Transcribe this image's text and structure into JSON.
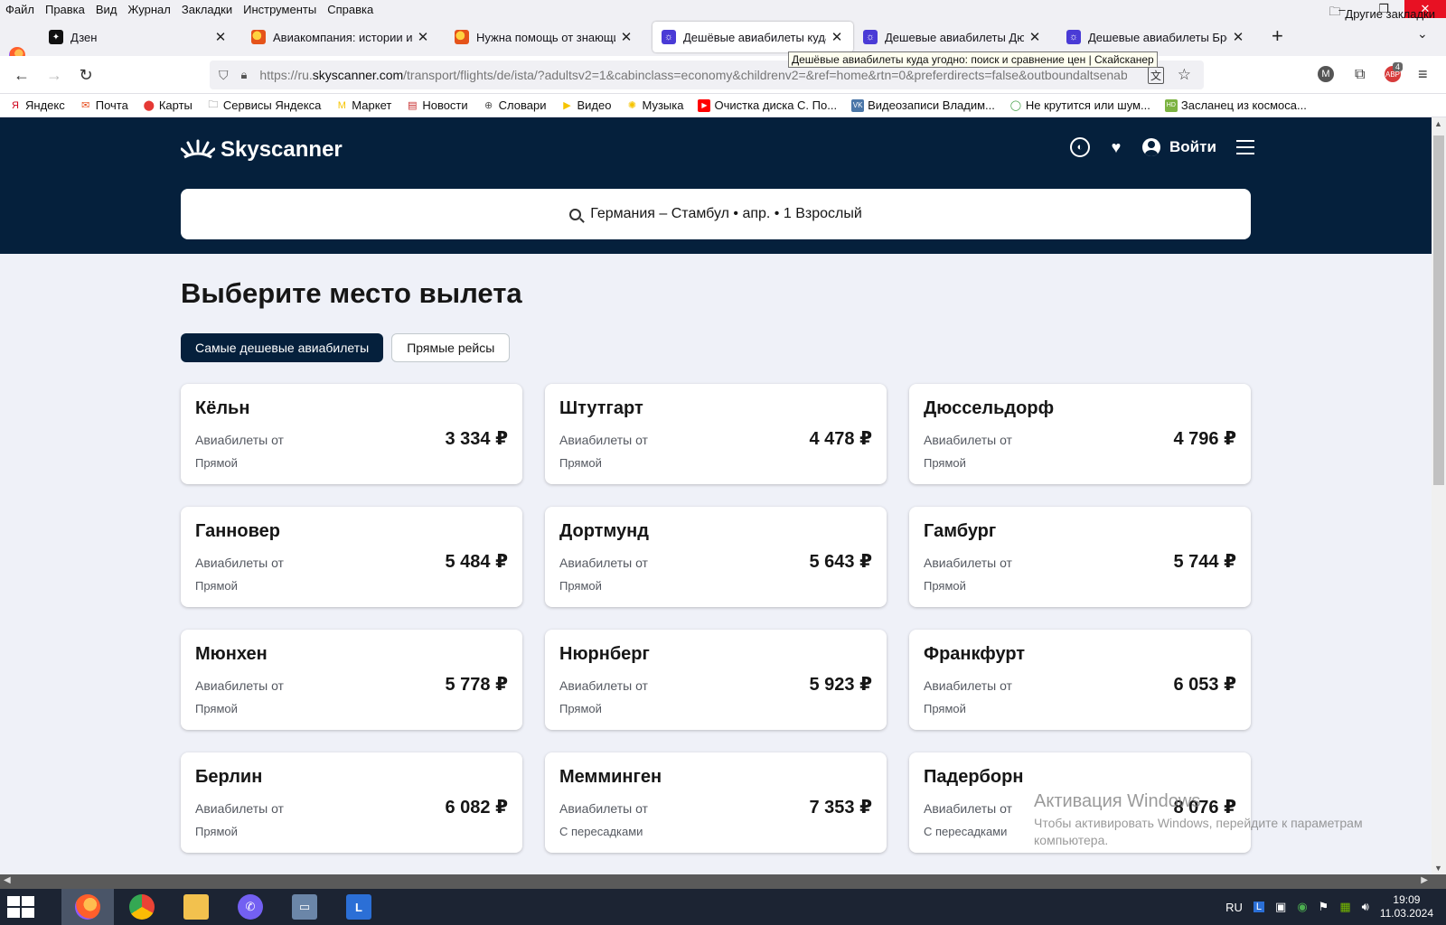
{
  "menubar": {
    "items": [
      "Файл",
      "Правка",
      "Вид",
      "Журнал",
      "Закладки",
      "Инструменты",
      "Справка"
    ],
    "minimize": "–",
    "restore": "❐",
    "close": "✕"
  },
  "tabs": [
    {
      "title": "Дзен",
      "icon": "dzen-icon"
    },
    {
      "title": "Авиакомпания: истории из жи",
      "icon": "duck-icon"
    },
    {
      "title": "Нужна помощь от знающих! |",
      "icon": "duck-icon"
    },
    {
      "title": "Дешёвые авиабилеты куда уг",
      "icon": "skyscanner-icon"
    },
    {
      "title": "Дешевые авиабилеты Дюссел",
      "icon": "skyscanner-icon"
    },
    {
      "title": "Дешевые авиабилеты Бремен",
      "icon": "skyscanner-icon"
    }
  ],
  "tab_tooltip": "Дешёвые авиабилеты куда угодно: поиск и сравнение цен | Скайсканер",
  "address": {
    "prefix": "https://ru.",
    "host": "skyscanner.com",
    "rest": "/transport/flights/de/ista/?adultsv2=1&cabinclass=economy&childrenv2=&ref=home&rtn=0&preferdirects=false&outboundaltsenab"
  },
  "extensions": {
    "m": "M",
    "abp": "ABP",
    "badge": "4"
  },
  "bookmarks": [
    {
      "label": "Яндекс",
      "icon": "yandex-icon",
      "color": "#d0021b"
    },
    {
      "label": "Почта",
      "icon": "mail-icon",
      "color": "#e64a19"
    },
    {
      "label": "Карты",
      "icon": "map-pin-icon",
      "color": "#e53935"
    },
    {
      "label": "Сервисы Яндекса",
      "icon": "folder-icon",
      "color": "#555555"
    },
    {
      "label": "Маркет",
      "icon": "market-icon",
      "color": "#f6c400"
    },
    {
      "label": "Новости",
      "icon": "news-icon",
      "color": "#c62828"
    },
    {
      "label": "Словари",
      "icon": "globe-icon",
      "color": "#555555"
    },
    {
      "label": "Видео",
      "icon": "video-icon",
      "color": "#f6c400"
    },
    {
      "label": "Музыка",
      "icon": "music-icon",
      "color": "#f6c400"
    },
    {
      "label": "Очистка диска С. По...",
      "icon": "youtube-icon",
      "color": "#ff0000"
    },
    {
      "label": "Видеозаписи Владим...",
      "icon": "vk-icon",
      "color": "#4a76a8"
    },
    {
      "label": "Не крутится или шум...",
      "icon": "green-circle-icon",
      "color": "#43a047"
    },
    {
      "label": "Засланец из космоса...",
      "icon": "hd-icon",
      "color": "#7cb342"
    }
  ],
  "bookmarks_other": "Другие закладки",
  "site": {
    "logo": "Skyscanner",
    "login": "Войти",
    "search": {
      "text": "Германия – Стамбул  •  апр.  •  1 Взрослый"
    },
    "title": "Выберите место вылета",
    "filters": [
      {
        "label": "Самые дешевые авиабилеты",
        "active": true
      },
      {
        "label": "Прямые рейсы",
        "active": false
      }
    ],
    "from_label": "Авиабилеты от",
    "cards": [
      {
        "city": "Кёльн",
        "price": "3 334 ₽",
        "stops": "Прямой"
      },
      {
        "city": "Штутгарт",
        "price": "4 478 ₽",
        "stops": "Прямой"
      },
      {
        "city": "Дюссельдорф",
        "price": "4 796 ₽",
        "stops": "Прямой"
      },
      {
        "city": "Ганновер",
        "price": "5 484 ₽",
        "stops": "Прямой"
      },
      {
        "city": "Дортмунд",
        "price": "5 643 ₽",
        "stops": "Прямой"
      },
      {
        "city": "Гамбург",
        "price": "5 744 ₽",
        "stops": "Прямой"
      },
      {
        "city": "Мюнхен",
        "price": "5 778 ₽",
        "stops": "Прямой"
      },
      {
        "city": "Нюрнберг",
        "price": "5 923 ₽",
        "stops": "Прямой"
      },
      {
        "city": "Франкфурт",
        "price": "6 053 ₽",
        "stops": "Прямой"
      },
      {
        "city": "Берлин",
        "price": "6 082 ₽",
        "stops": "Прямой"
      },
      {
        "city": "Мемминген",
        "price": "7 353 ₽",
        "stops": "С пересадками"
      },
      {
        "city": "Падерборн",
        "price": "8 076 ₽",
        "stops": "С пересадками"
      }
    ],
    "colors": {
      "header_bg": "#05203c",
      "page_bg": "#eff1f8",
      "text": "#161616"
    }
  },
  "activation": {
    "title": "Активация Windows",
    "text": "Чтобы активировать Windows, перейдите к параметрам компьютера."
  },
  "taskbar": {
    "apps": [
      "firefox-icon",
      "chrome-icon",
      "file-explorer-icon",
      "viber-icon",
      "remote-desktop-icon",
      "l-app-icon"
    ],
    "lang": "RU",
    "time": "19:09",
    "date": "11.03.2024"
  }
}
